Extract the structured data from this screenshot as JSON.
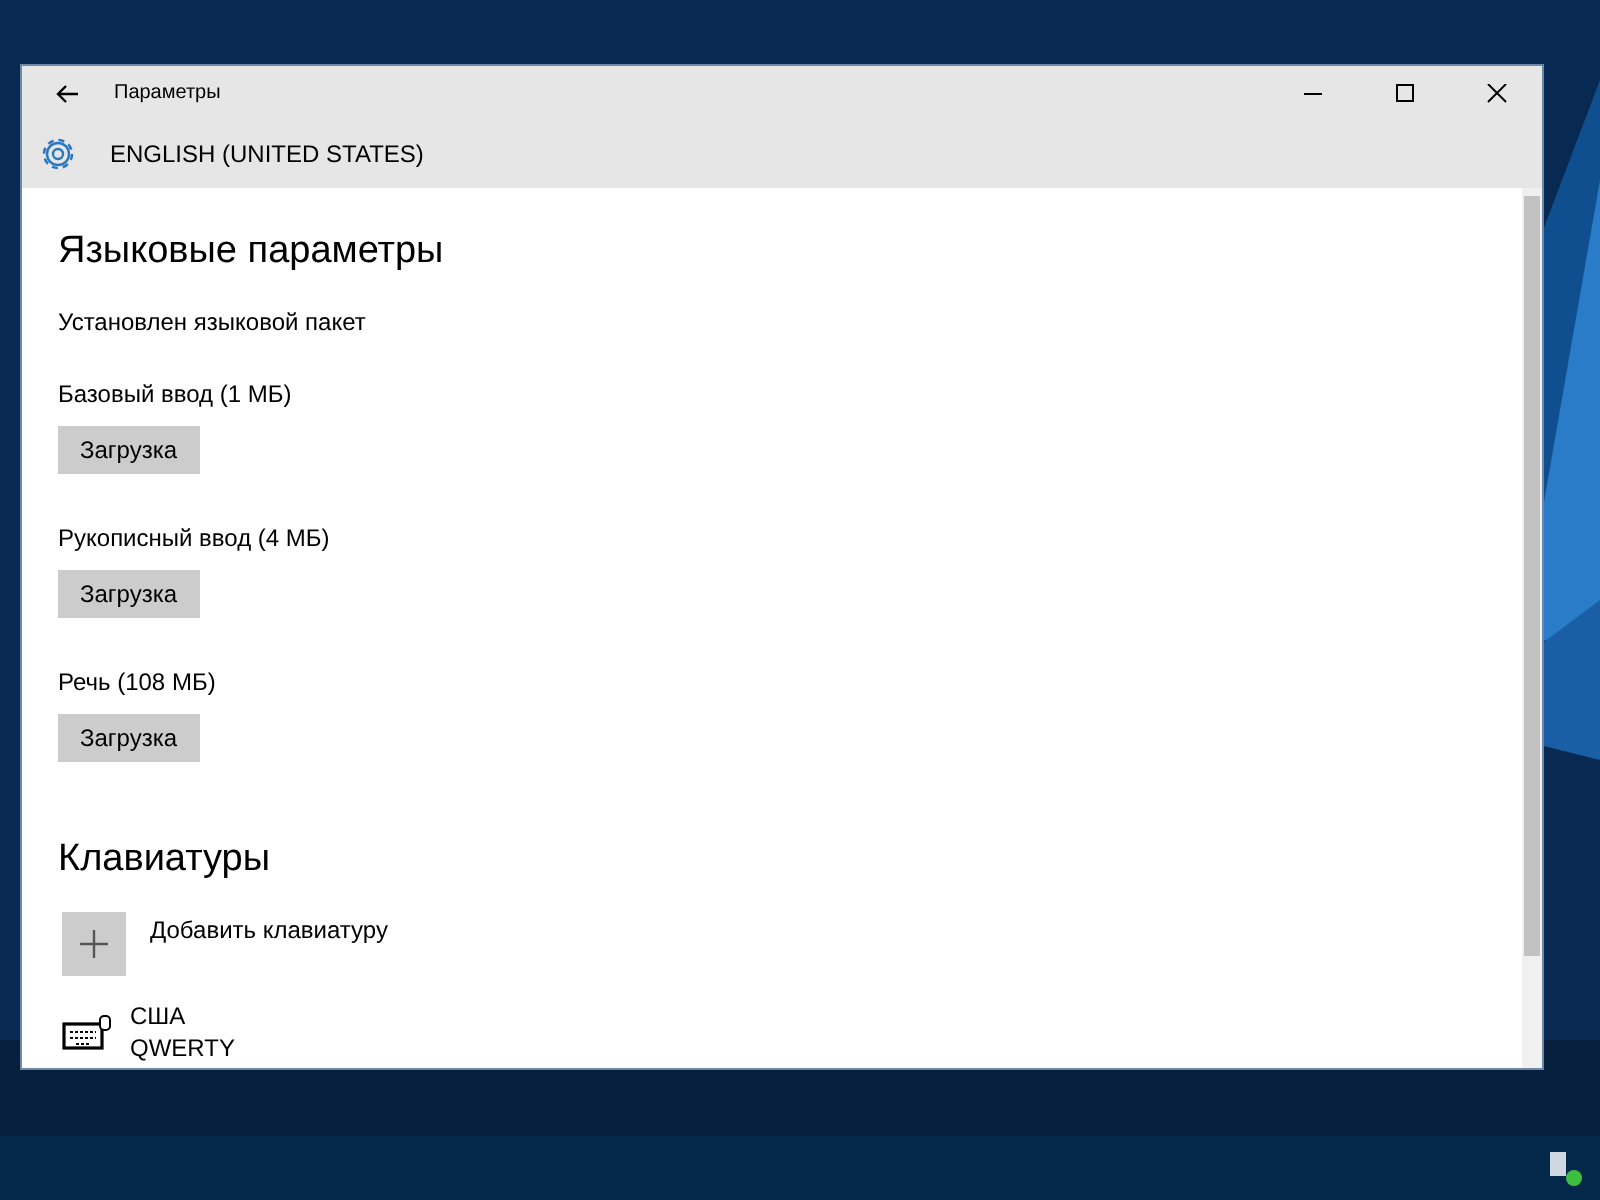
{
  "window": {
    "title": "Параметры"
  },
  "header": {
    "title": "ENGLISH (UNITED STATES)"
  },
  "sections": [
    {
      "title": "Языковые параметры",
      "note": "Установлен языковой пакет",
      "items": [
        {
          "label": "Базовый ввод (1 МБ)",
          "button": "Загрузка"
        },
        {
          "label": "Рукописный ввод (4 МБ)",
          "button": "Загрузка"
        },
        {
          "label": "Речь (108 МБ)",
          "button": "Загрузка"
        }
      ]
    },
    {
      "title": "Клавиатуры",
      "add_label": "Добавить клавиатуру",
      "keyboards": [
        {
          "name": "США",
          "layout": "QWERTY"
        }
      ]
    }
  ]
}
